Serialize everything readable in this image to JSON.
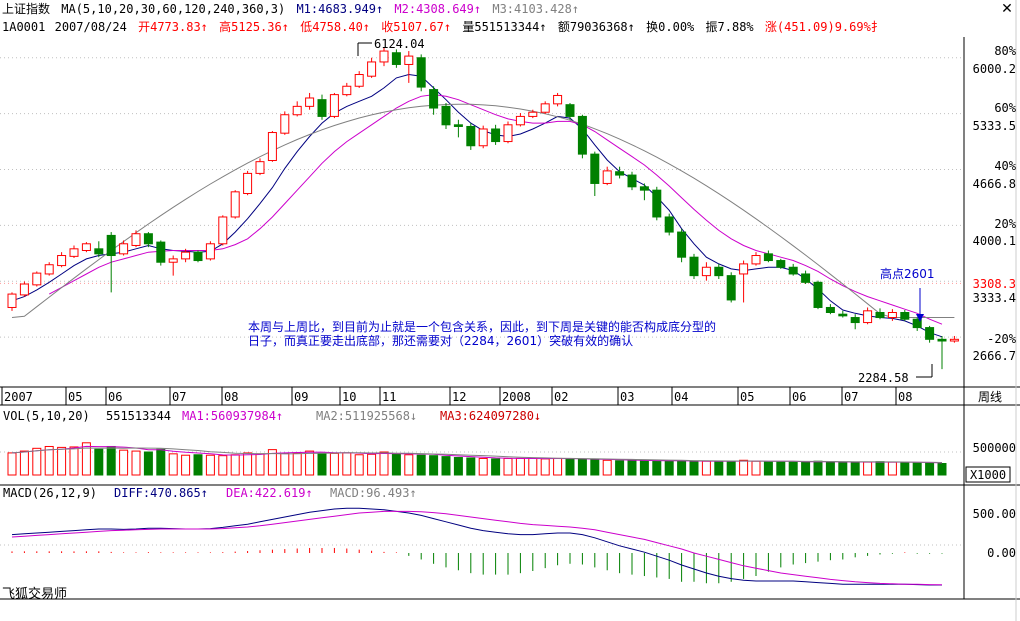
{
  "header": {
    "title": "上证指数",
    "ma_params": "MA(5,10,20,30,60,120,240,360,3)",
    "ma_values": [
      {
        "label": "M1:4683.949",
        "arrow": "↑",
        "color": "#000080"
      },
      {
        "label": "M2:4308.649",
        "arrow": "↑",
        "color": "#cc00cc"
      },
      {
        "label": "M3:4103.428",
        "arrow": "↑",
        "color": "#808080"
      }
    ],
    "close_icon": "close-icon"
  },
  "quote": {
    "code": "1A0001",
    "date": "2007/08/24",
    "open_label": "开",
    "open": "4773.83",
    "high_label": "高",
    "high": "5125.36",
    "low_label": "低",
    "low": "4758.40",
    "close_label": "收",
    "close": "5107.67",
    "vol_label": "量",
    "vol": "551513344",
    "amt_label": "额",
    "amt": "79036368",
    "turn_label": "换",
    "turn": "0.00%",
    "amp_label": "振",
    "amp": "7.88%",
    "chg_label": "涨",
    "chg": "(451.09)9.69%",
    "tail": "扌"
  },
  "price_axis": {
    "pct_labels": [
      "80%",
      "60%",
      "40%",
      "20%",
      "-20%"
    ],
    "price_labels": [
      "6000.2",
      "5333.5",
      "4666.8",
      "4000.1",
      "3333.4",
      "2666.7"
    ],
    "ref_price": "3308.3"
  },
  "annotations": {
    "high_price": "6124.04",
    "low_price": "2284.58",
    "peak_label": "高点2601",
    "note": "本周与上周比，到目前为止就是一个包含关系，因此，到下周是关键的能否构成底分型的日子，而真正要走出底部，那还需要对（2284，2601）突破有效的确认"
  },
  "time_axis": {
    "labels": [
      "2007",
      "05",
      "06",
      "07",
      "08",
      "09",
      "10",
      "11",
      "12",
      "2008",
      "02",
      "03",
      "04",
      "05",
      "06",
      "07",
      "08"
    ],
    "period_button": "周线"
  },
  "vol_panel": {
    "title": "VOL(5,10,20)",
    "value": "551513344",
    "ma1": "MA1:560937984",
    "ma1_arrow": "↑",
    "ma2": "MA2:511925568",
    "ma2_arrow": "↓",
    "ma3": "MA3:624097280",
    "ma3_arrow": "↓",
    "axis_label": "500000",
    "unit": "X1000"
  },
  "macd_panel": {
    "title": "MACD(26,12,9)",
    "diff": "DIFF:470.865",
    "diff_arrow": "↑",
    "dea": "DEA:422.619",
    "dea_arrow": "↑",
    "macd": "MACD:96.493",
    "macd_arrow": "↑",
    "axis_labels": [
      "500.00",
      "0.00"
    ]
  },
  "footer": {
    "brand": "飞狐交易师"
  },
  "colors": {
    "up": "#ff0000",
    "down": "#008000",
    "ma1": "#000080",
    "ma2": "#cc00cc",
    "ma3": "#808080",
    "note": "#0000cc"
  },
  "chart_data": {
    "type": "candlestick",
    "title": "上证指数",
    "period": "weekly",
    "x_range": [
      "2007-01",
      "2008-08"
    ],
    "ylim": [
      2284.58,
      6124.04
    ],
    "candles": [
      {
        "o": 3020,
        "c": 3180,
        "h": 3200,
        "l": 2980
      },
      {
        "o": 3170,
        "c": 3300,
        "h": 3330,
        "l": 3150
      },
      {
        "o": 3290,
        "c": 3430,
        "h": 3450,
        "l": 3270
      },
      {
        "o": 3420,
        "c": 3530,
        "h": 3560,
        "l": 3400
      },
      {
        "o": 3520,
        "c": 3640,
        "h": 3680,
        "l": 3500
      },
      {
        "o": 3630,
        "c": 3720,
        "h": 3760,
        "l": 3610
      },
      {
        "o": 3700,
        "c": 3780,
        "h": 3800,
        "l": 3680
      },
      {
        "o": 3720,
        "c": 3660,
        "h": 3810,
        "l": 3620
      },
      {
        "o": 3880,
        "c": 3640,
        "h": 3920,
        "l": 3200
      },
      {
        "o": 3660,
        "c": 3780,
        "h": 3820,
        "l": 3640
      },
      {
        "o": 3760,
        "c": 3900,
        "h": 3940,
        "l": 3740
      },
      {
        "o": 3900,
        "c": 3780,
        "h": 3920,
        "l": 3740
      },
      {
        "o": 3800,
        "c": 3560,
        "h": 3820,
        "l": 3520
      },
      {
        "o": 3560,
        "c": 3600,
        "h": 3640,
        "l": 3400
      },
      {
        "o": 3600,
        "c": 3680,
        "h": 3720,
        "l": 3560
      },
      {
        "o": 3680,
        "c": 3580,
        "h": 3700,
        "l": 3560
      },
      {
        "o": 3600,
        "c": 3780,
        "h": 3810,
        "l": 3580
      },
      {
        "o": 3780,
        "c": 4100,
        "h": 4120,
        "l": 3760
      },
      {
        "o": 4100,
        "c": 4400,
        "h": 4420,
        "l": 4080
      },
      {
        "o": 4380,
        "c": 4620,
        "h": 4650,
        "l": 4360
      },
      {
        "o": 4620,
        "c": 4760,
        "h": 4800,
        "l": 4600
      },
      {
        "o": 4773.83,
        "c": 5107.67,
        "h": 5125.36,
        "l": 4758.4
      },
      {
        "o": 5100,
        "c": 5320,
        "h": 5360,
        "l": 5080
      },
      {
        "o": 5320,
        "c": 5420,
        "h": 5480,
        "l": 5300
      },
      {
        "o": 5420,
        "c": 5520,
        "h": 5580,
        "l": 5380
      },
      {
        "o": 5500,
        "c": 5300,
        "h": 5560,
        "l": 5260
      },
      {
        "o": 5300,
        "c": 5560,
        "h": 5580,
        "l": 5280
      },
      {
        "o": 5560,
        "c": 5660,
        "h": 5700,
        "l": 5540
      },
      {
        "o": 5660,
        "c": 5800,
        "h": 5840,
        "l": 5640
      },
      {
        "o": 5780,
        "c": 5950,
        "h": 6000,
        "l": 5760
      },
      {
        "o": 5950,
        "c": 6080,
        "h": 6124.04,
        "l": 5900
      },
      {
        "o": 6060,
        "c": 5920,
        "h": 6100,
        "l": 5880
      },
      {
        "o": 5920,
        "c": 6020,
        "h": 6080,
        "l": 5700
      },
      {
        "o": 6000,
        "c": 5650,
        "h": 6040,
        "l": 5600
      },
      {
        "o": 5620,
        "c": 5400,
        "h": 5660,
        "l": 5320
      },
      {
        "o": 5420,
        "c": 5200,
        "h": 5460,
        "l": 5150
      },
      {
        "o": 5200,
        "c": 5180,
        "h": 5260,
        "l": 5050
      },
      {
        "o": 5180,
        "c": 4950,
        "h": 5220,
        "l": 4900
      },
      {
        "o": 4950,
        "c": 5150,
        "h": 5190,
        "l": 4920
      },
      {
        "o": 5150,
        "c": 5000,
        "h": 5200,
        "l": 4960
      },
      {
        "o": 5000,
        "c": 5200,
        "h": 5240,
        "l": 4980
      },
      {
        "o": 5200,
        "c": 5300,
        "h": 5340,
        "l": 5180
      },
      {
        "o": 5300,
        "c": 5350,
        "h": 5380,
        "l": 5280
      },
      {
        "o": 5350,
        "c": 5450,
        "h": 5480,
        "l": 5330
      },
      {
        "o": 5450,
        "c": 5550,
        "h": 5580,
        "l": 5420
      },
      {
        "o": 5440,
        "c": 5300,
        "h": 5460,
        "l": 5260
      },
      {
        "o": 5300,
        "c": 4850,
        "h": 5320,
        "l": 4800
      },
      {
        "o": 4850,
        "c": 4500,
        "h": 4880,
        "l": 4350
      },
      {
        "o": 4500,
        "c": 4650,
        "h": 4700,
        "l": 4480
      },
      {
        "o": 4640,
        "c": 4600,
        "h": 4700,
        "l": 4560
      },
      {
        "o": 4600,
        "c": 4460,
        "h": 4640,
        "l": 4420
      },
      {
        "o": 4460,
        "c": 4420,
        "h": 4500,
        "l": 4300
      },
      {
        "o": 4420,
        "c": 4100,
        "h": 4460,
        "l": 4060
      },
      {
        "o": 4100,
        "c": 3920,
        "h": 4140,
        "l": 3880
      },
      {
        "o": 3920,
        "c": 3620,
        "h": 3960,
        "l": 3560
      },
      {
        "o": 3620,
        "c": 3400,
        "h": 3660,
        "l": 3360
      },
      {
        "o": 3400,
        "c": 3500,
        "h": 3560,
        "l": 3340
      },
      {
        "o": 3500,
        "c": 3400,
        "h": 3540,
        "l": 3360
      },
      {
        "o": 3400,
        "c": 3110,
        "h": 3440,
        "l": 3080
      },
      {
        "o": 3420,
        "c": 3540,
        "h": 3580,
        "l": 3080
      },
      {
        "o": 3540,
        "c": 3640,
        "h": 3680,
        "l": 3520
      },
      {
        "o": 3660,
        "c": 3580,
        "h": 3700,
        "l": 3560
      },
      {
        "o": 3580,
        "c": 3500,
        "h": 3600,
        "l": 3480
      },
      {
        "o": 3500,
        "c": 3420,
        "h": 3540,
        "l": 3400
      },
      {
        "o": 3420,
        "c": 3320,
        "h": 3460,
        "l": 3300
      },
      {
        "o": 3320,
        "c": 3020,
        "h": 3340,
        "l": 3000
      },
      {
        "o": 3020,
        "c": 2960,
        "h": 3060,
        "l": 2940
      },
      {
        "o": 2940,
        "c": 2920,
        "h": 2980,
        "l": 2900
      },
      {
        "o": 2900,
        "c": 2840,
        "h": 2940,
        "l": 2760
      },
      {
        "o": 2840,
        "c": 2980,
        "h": 3020,
        "l": 2820
      },
      {
        "o": 2960,
        "c": 2900,
        "h": 3010,
        "l": 2880
      },
      {
        "o": 2900,
        "c": 2960,
        "h": 3000,
        "l": 2860
      },
      {
        "o": 2960,
        "c": 2880,
        "h": 2990,
        "l": 2860
      },
      {
        "o": 2880,
        "c": 2780,
        "h": 2900,
        "l": 2740
      },
      {
        "o": 2780,
        "c": 2640,
        "h": 2800,
        "l": 2600
      },
      {
        "o": 2640,
        "c": 2620,
        "h": 2680,
        "l": 2284.58
      },
      {
        "o": 2620,
        "c": 2640,
        "h": 2680,
        "l": 2600
      }
    ],
    "ma_lines": [
      {
        "name": "M1",
        "values": [
          3100,
          3150,
          3230,
          3320,
          3420,
          3520,
          3600,
          3640,
          3660,
          3680,
          3720,
          3760,
          3720,
          3700,
          3690,
          3680,
          3690,
          3780,
          3920,
          4080,
          4260,
          4450,
          4680,
          4880,
          5060,
          5220,
          5340,
          5420,
          5480,
          5540,
          5640,
          5760,
          5800,
          5780,
          5640,
          5500,
          5350,
          5220,
          5130,
          5080,
          5060,
          5090,
          5150,
          5220,
          5300,
          5280,
          5150,
          4960,
          4780,
          4640,
          4560,
          4480,
          4340,
          4180,
          3960,
          3780,
          3620,
          3540,
          3480,
          3460,
          3480,
          3500,
          3500,
          3460,
          3360,
          3240,
          3100,
          2990,
          2950,
          2920,
          2900,
          2890,
          2860,
          2800,
          2720,
          2670
        ]
      },
      {
        "name": "M2",
        "values": [
          null,
          null,
          null,
          3180,
          3260,
          3340,
          3420,
          3500,
          3560,
          3600,
          3640,
          3680,
          3690,
          3700,
          3700,
          3700,
          3700,
          3720,
          3770,
          3840,
          3960,
          4100,
          4260,
          4420,
          4580,
          4740,
          4880,
          5000,
          5100,
          5200,
          5300,
          5400,
          5480,
          5540,
          5560,
          5540,
          5500,
          5440,
          5380,
          5320,
          5270,
          5240,
          5220,
          5220,
          5240,
          5240,
          5200,
          5120,
          5020,
          4920,
          4820,
          4720,
          4600,
          4470,
          4330,
          4190,
          4060,
          3940,
          3840,
          3760,
          3700,
          3660,
          3620,
          3580,
          3520,
          3450,
          3360,
          3280,
          3210,
          3150,
          3100,
          3050,
          3000,
          2950,
          2880,
          2820
        ]
      }
    ],
    "volume": [
      480000,
      520000,
      580000,
      620000,
      600000,
      610000,
      700000,
      560000,
      620000,
      540000,
      520000,
      500000,
      560000,
      460000,
      430000,
      440000,
      430000,
      420000,
      440000,
      480000,
      460000,
      551513.344,
      470000,
      480000,
      520000,
      470000,
      470000,
      480000,
      440000,
      450000,
      500000,
      460000,
      440000,
      430000,
      420000,
      400000,
      380000,
      370000,
      360000,
      350000,
      360000,
      360000,
      360000,
      350000,
      360000,
      350000,
      340000,
      330000,
      320000,
      310000,
      320000,
      310000,
      300000,
      310000,
      300000,
      300000,
      300000,
      290000,
      300000,
      320000,
      300000,
      290000,
      290000,
      290000,
      280000,
      300000,
      280000,
      270000,
      280000,
      280000,
      290000,
      280000,
      270000,
      260000,
      260000,
      250000
    ],
    "macd_diff": [
      230,
      240,
      250,
      260,
      270,
      280,
      290,
      300,
      300,
      295,
      300,
      310,
      310,
      305,
      300,
      300,
      305,
      320,
      340,
      360,
      390,
      420,
      450,
      480,
      510,
      530,
      550,
      560,
      560,
      550,
      540,
      520,
      500,
      470,
      430,
      390,
      350,
      310,
      280,
      260,
      240,
      230,
      230,
      240,
      250,
      250,
      230,
      190,
      140,
      90,
      50,
      10,
      -40,
      -90,
      -150,
      -200,
      -250,
      -290,
      -320,
      -340,
      -350,
      -350,
      -350,
      -350,
      -360,
      -370,
      -380,
      -390,
      -390,
      -390,
      -390,
      -390,
      -390,
      -395,
      -400,
      -400
    ],
    "macd_dea": [
      200,
      210,
      220,
      230,
      240,
      250,
      260,
      270,
      280,
      285,
      290,
      295,
      300,
      300,
      300,
      300,
      300,
      305,
      315,
      325,
      340,
      360,
      380,
      400,
      420,
      440,
      460,
      480,
      500,
      510,
      520,
      520,
      520,
      515,
      505,
      490,
      470,
      450,
      430,
      410,
      390,
      370,
      355,
      345,
      335,
      325,
      310,
      290,
      260,
      230,
      200,
      170,
      130,
      90,
      50,
      0,
      -40,
      -80,
      -120,
      -160,
      -190,
      -220,
      -250,
      -270,
      -290,
      -310,
      -330,
      -345,
      -360,
      -370,
      -380,
      -385,
      -390,
      -390,
      -395,
      -398
    ]
  }
}
